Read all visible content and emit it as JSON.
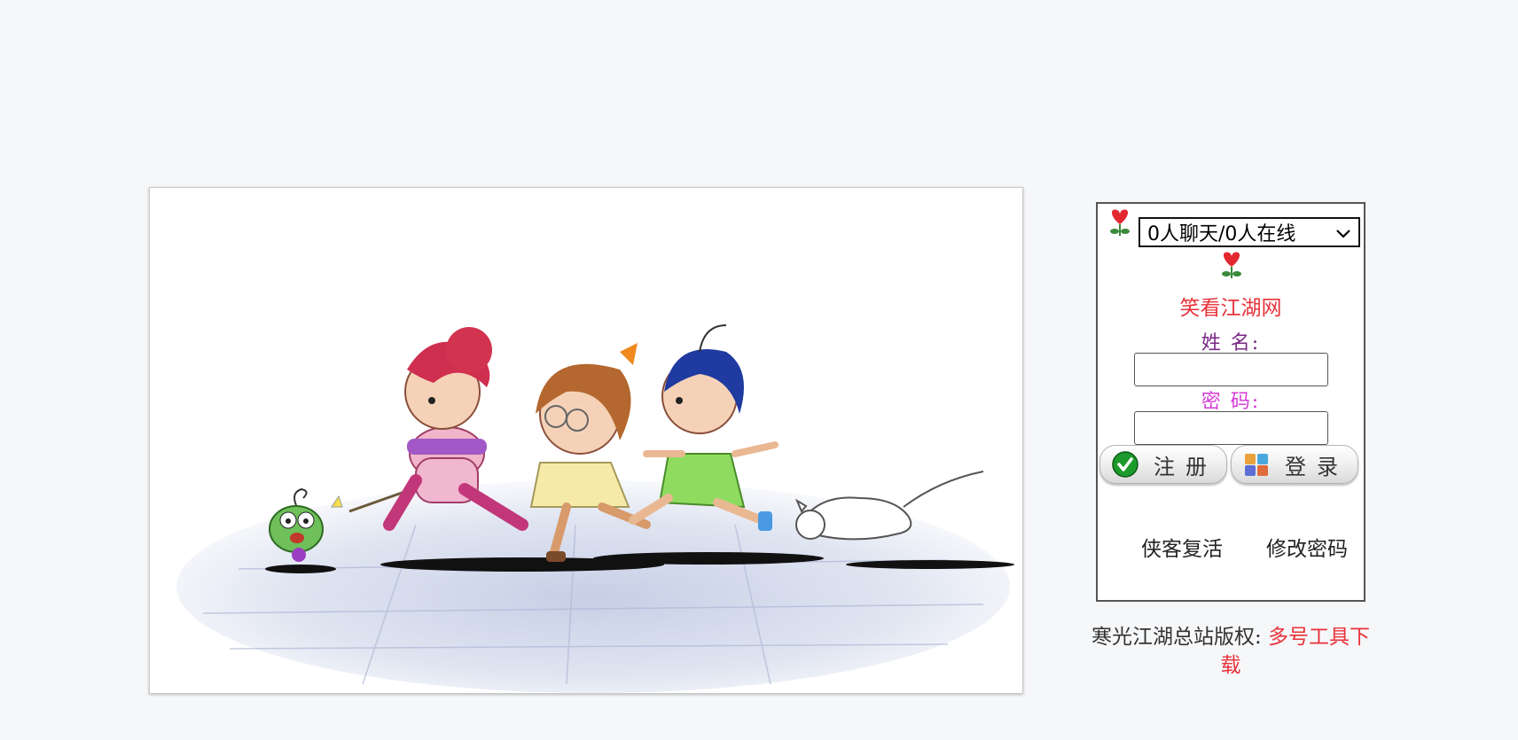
{
  "banner": {
    "alt": "cartoon characters running"
  },
  "panel": {
    "online_select": {
      "selected": "0人聊天/0人在线",
      "icon": "chevron-down-icon"
    },
    "site_name": "笑看江湖网",
    "name_label": "姓 名:",
    "password_label": "密 码:",
    "name_value": "",
    "password_value": "",
    "register_button": "注册",
    "login_button": "登录",
    "links": {
      "revive": "侠客复活",
      "change_password": "修改密码"
    },
    "icons": [
      "heart-flower-icon",
      "heart-flower-icon"
    ]
  },
  "footer": {
    "copyright": "寒光江湖总站版权:",
    "download_link": "多号工具下载"
  },
  "colors": {
    "background": "#f6f7f9",
    "accent_red": "#e8323a",
    "name_label": "#7a2a86",
    "password_label": "#d63bd6"
  }
}
